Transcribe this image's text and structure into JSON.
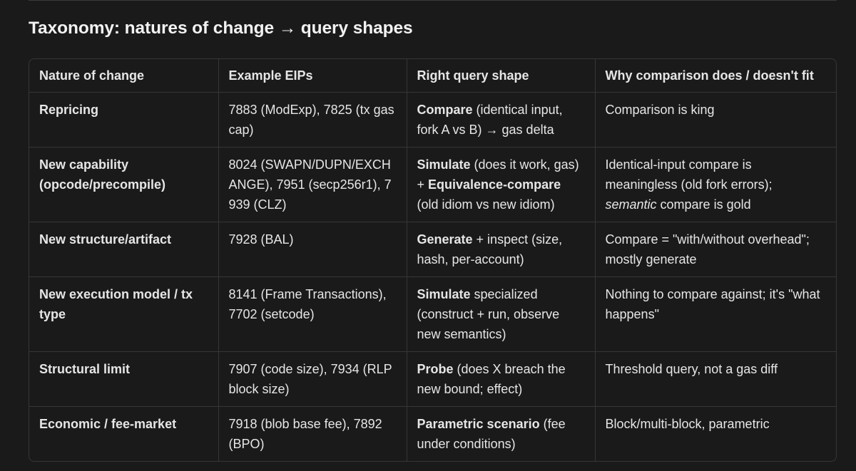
{
  "heading": "Taxonomy: natures of change → query shapes",
  "table": {
    "headers": [
      "Nature of change",
      "Example EIPs",
      "Right query shape",
      "Why comparison does / doesn't fit"
    ],
    "rows": [
      {
        "nature": "Repricing",
        "eips": "7883 (ModExp), 7825 (tx gas cap)",
        "shape": {
          "b1": "Compare",
          "t1": " (identical input, fork A vs B) → gas delta",
          "b2": "",
          "t2": ""
        },
        "why": {
          "i1": "",
          "t1": "Comparison is king"
        }
      },
      {
        "nature": "New capability (opcode/precompile)",
        "eips": "8024 (SWAPN/DUPN/EXCHANGE), 7951 (secp256r1), 7939 (CLZ)",
        "shape": {
          "b1": "Simulate",
          "t1": " (does it work, gas) + ",
          "b2": "Equivalence-compare",
          "t2": " (old idiom vs new idiom)"
        },
        "why": {
          "t0": "Identical-input compare is meaningless (old fork errors); ",
          "i1": "semantic",
          "t1": " compare is gold"
        }
      },
      {
        "nature": "New structure/artifact",
        "eips": "7928 (BAL)",
        "shape": {
          "b1": "Generate",
          "t1": " + inspect (size, hash, per-account)",
          "b2": "",
          "t2": ""
        },
        "why": {
          "i1": "",
          "t1": "Compare = \"with/without overhead\"; mostly generate"
        }
      },
      {
        "nature": "New execution model / tx type",
        "eips": "8141 (Frame Transactions), 7702 (setcode)",
        "shape": {
          "b1": "Simulate",
          "t1": " specialized (construct + run, observe new semantics)",
          "b2": "",
          "t2": ""
        },
        "why": {
          "i1": "",
          "t1": "Nothing to compare against; it's \"what happens\""
        }
      },
      {
        "nature": "Structural limit",
        "eips": "7907 (code size), 7934 (RLP block size)",
        "shape": {
          "b1": "Probe",
          "t1": " (does X breach the new bound; effect)",
          "b2": "",
          "t2": ""
        },
        "why": {
          "i1": "",
          "t1": "Threshold query, not a gas diff"
        }
      },
      {
        "nature": "Economic / fee-market",
        "eips": "7918 (blob base fee), 7892 (BPO)",
        "shape": {
          "b1": "Parametric scenario",
          "t1": " (fee under conditions)",
          "b2": "",
          "t2": ""
        },
        "why": {
          "i1": "",
          "t1": "Block/multi-block, parametric"
        }
      }
    ]
  }
}
